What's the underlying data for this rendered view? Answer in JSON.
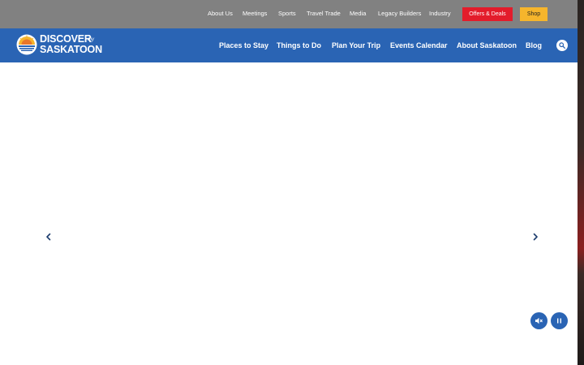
{
  "utility_nav": {
    "items": [
      "About Us",
      "Meetings",
      "Sports",
      "Travel Trade",
      "Media",
      "Legacy Builders",
      "Industry"
    ],
    "offers_label": "Offers & Deals",
    "shop_label": "Shop"
  },
  "logo": {
    "line1": "DISCOVER",
    "line2": "SASKATOON",
    "script": "my"
  },
  "main_nav": {
    "items": [
      "Places to Stay",
      "Things to Do",
      "Plan Your Trip",
      "Events Calendar",
      "About Saskatoon",
      "Blog"
    ]
  },
  "icons": {
    "search": "search-icon",
    "prev": "chevron-left-icon",
    "next": "chevron-right-icon",
    "mute": "speaker-mute-icon",
    "pause": "pause-icon"
  },
  "colors": {
    "utility_bar": "#818181",
    "nav_bar": "#2a64b4",
    "offers": "#e31c2b",
    "shop": "#f6b52c",
    "accent_blue": "#2a64b4"
  }
}
